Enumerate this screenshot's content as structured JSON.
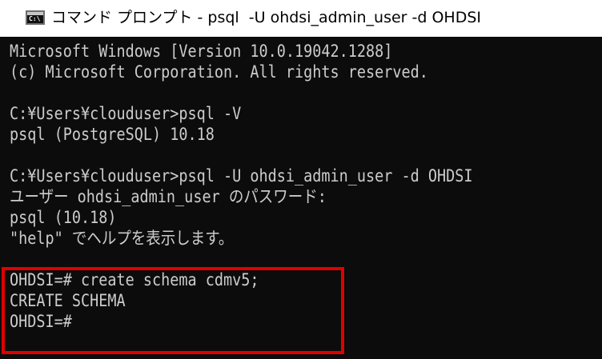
{
  "window": {
    "title": "コマンド プロンプト - psql  -U ohdsi_admin_user -d OHDSI",
    "icon": "console-icon",
    "icon_glyph": "C:\\"
  },
  "console": {
    "lines": [
      "Microsoft Windows [Version 10.0.19042.1288]",
      "(c) Microsoft Corporation. All rights reserved.",
      "",
      "C:¥Users¥clouduser>psql -V",
      "psql (PostgreSQL) 10.18",
      "",
      "C:¥Users¥clouduser>psql -U ohdsi_admin_user -d OHDSI",
      "ユーザー ohdsi_admin_user のパスワード:",
      "psql (10.18)",
      "\"help\" でヘルプを表示します。",
      "",
      "OHDSI=# create schema cdmv5;",
      "CREATE SCHEMA",
      "OHDSI=#"
    ]
  },
  "colors": {
    "console_background": "#0c0c0c",
    "console_text": "#cccccc",
    "highlight_border": "#e00000"
  }
}
